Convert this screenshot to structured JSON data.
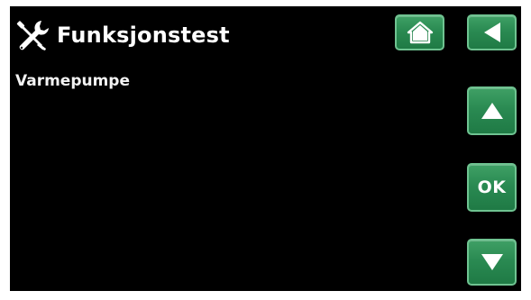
{
  "header": {
    "title": "Funksjonstest",
    "title_icon": "wrench-screwdriver-icon"
  },
  "menu": {
    "items": [
      {
        "label": "Varmepumpe"
      }
    ]
  },
  "nav": {
    "home_icon": "home-icon",
    "back_icon": "back-arrow-icon",
    "up_icon": "up-arrow-icon",
    "ok_label": "OK",
    "down_icon": "down-arrow-icon"
  },
  "colors": {
    "background": "#000000",
    "button": "#2a8a52",
    "button_border": "#6fc391",
    "text": "#ffffff"
  }
}
